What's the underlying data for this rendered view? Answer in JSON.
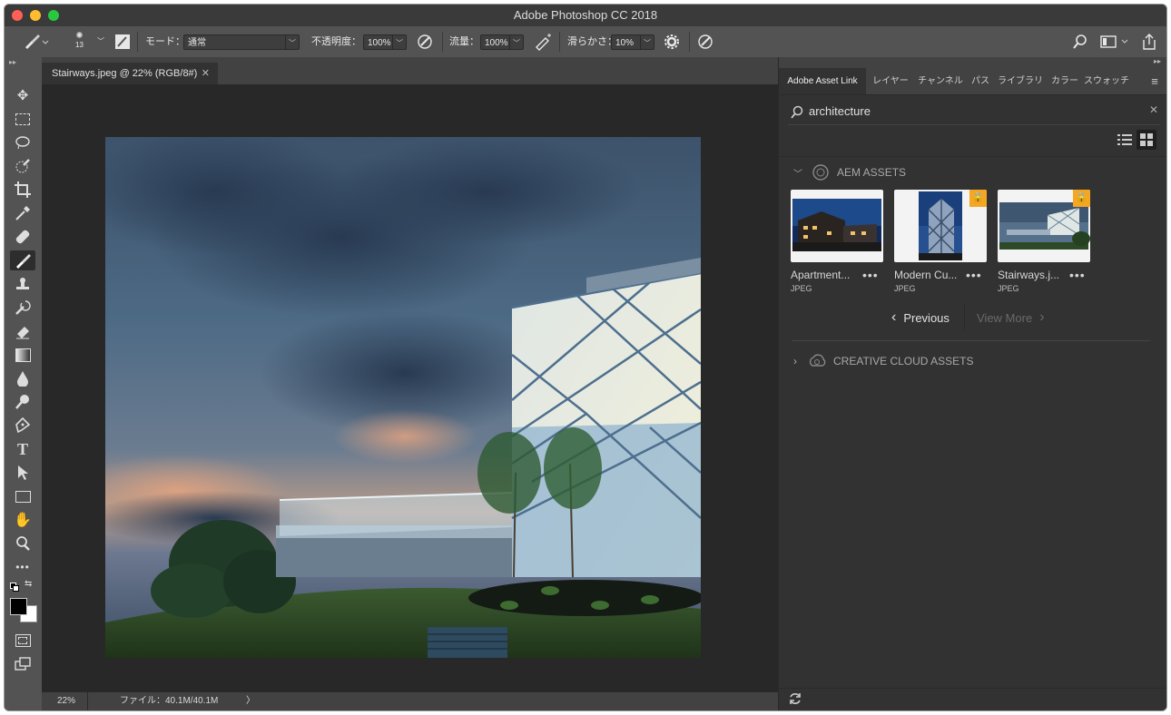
{
  "app": {
    "title": "Adobe Photoshop CC 2018"
  },
  "options": {
    "brush_size": "13",
    "mode_label": "モード：",
    "mode_value": "通常",
    "opacity_label": "不透明度：",
    "opacity_value": "100%",
    "flow_label": "流量：",
    "flow_value": "100%",
    "smoothing_label": "滑らかさ：",
    "smoothing_value": "10%"
  },
  "document": {
    "tab_title": "Stairways.jpeg @ 22% (RGB/8#)",
    "zoom": "22%",
    "file_info": "ファイル：40.1M/40.1M",
    "nav_arrow": "〉"
  },
  "panel": {
    "tabs": [
      {
        "label": "Adobe Asset Link"
      },
      {
        "label": "レイヤー"
      },
      {
        "label": "チャンネル"
      },
      {
        "label": "パス"
      },
      {
        "label": "ライブラリ"
      },
      {
        "label": "カラー"
      },
      {
        "label": "スウォッチ"
      }
    ],
    "search_value": "architecture",
    "aem_section": "AEM ASSETS",
    "cc_section": "CREATIVE CLOUD ASSETS",
    "assets": [
      {
        "name": "Apartment...",
        "type": "JPEG",
        "locked": false
      },
      {
        "name": "Modern Cu...",
        "type": "JPEG",
        "locked": true
      },
      {
        "name": "Stairways.j...",
        "type": "JPEG",
        "locked": true
      }
    ],
    "more_glyph": "•••",
    "previous_label": "Previous",
    "view_more_label": "View More"
  },
  "colors": {
    "accent_lock": "#f5a623",
    "panel_bg": "#323232",
    "toolbar_bg": "#535353"
  }
}
